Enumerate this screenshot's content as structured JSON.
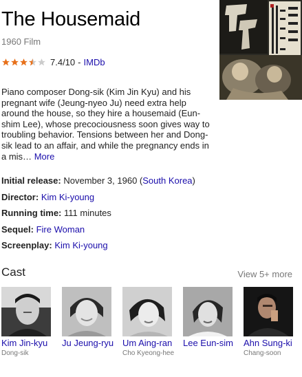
{
  "title": "The Housemaid",
  "subtitle": "1960 Film",
  "rating": {
    "stars": 3.5,
    "out_of": 5,
    "score": "7.4/10",
    "separator": "-",
    "source": "IMDb"
  },
  "poster": {
    "alt_text": "Movie poster"
  },
  "description": {
    "text": "Piano composer Dong-sik (Kim Jin Kyu) and his pregnant wife (Jeung-nyeo Ju) need extra help around the house, so they hire a housemaid (Eun-shim Lee), whose precociousness soon gives way to troubling behavior. Tensions between her and Dong-sik lead to an affair, and while the pregnancy ends in a mis…",
    "more_label": "More"
  },
  "facts": {
    "initial_release": {
      "label": "Initial release:",
      "date": "November 3, 1960 (",
      "country": "South Korea",
      "close": ")"
    },
    "director": {
      "label": "Director:",
      "value": "Kim Ki-young"
    },
    "running_time": {
      "label": "Running time:",
      "value": "111 minutes"
    },
    "sequel": {
      "label": "Sequel:",
      "value": "Fire Woman"
    },
    "screenplay": {
      "label": "Screenplay:",
      "value": "Kim Ki-young"
    }
  },
  "cast": {
    "heading": "Cast",
    "view_more": "View 5+ more",
    "members": [
      {
        "name": "Kim Jin-kyu",
        "role": "Dong-sik"
      },
      {
        "name": "Ju Jeung-ryu",
        "role": ""
      },
      {
        "name": "Um Aing-ran",
        "role": "Cho Kyeong-hee"
      },
      {
        "name": "Lee Eun-sim",
        "role": ""
      },
      {
        "name": "Ahn Sung-ki",
        "role": "Chang-soon"
      }
    ]
  },
  "colors": {
    "link": "#1a0dab",
    "muted": "#777777",
    "star": "#e7711b",
    "star_empty": "#cccccc"
  }
}
